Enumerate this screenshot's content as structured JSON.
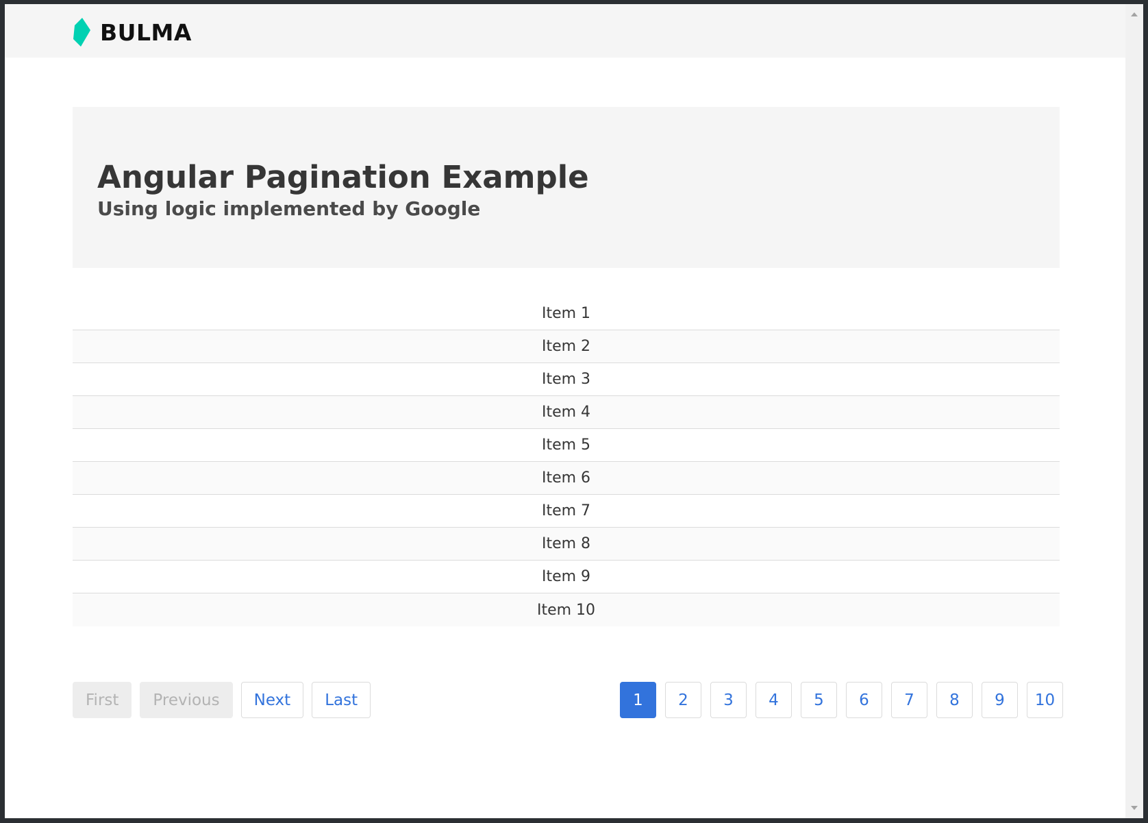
{
  "navbar": {
    "brand_text": "BULMA",
    "brand_color": "#00d1b2"
  },
  "hero": {
    "title": "Angular Pagination Example",
    "subtitle": "Using logic implemented by Google"
  },
  "items": [
    "Item 1",
    "Item 2",
    "Item 3",
    "Item 4",
    "Item 5",
    "Item 6",
    "Item 7",
    "Item 8",
    "Item 9",
    "Item 10"
  ],
  "pagination": {
    "first_label": "First",
    "previous_label": "Previous",
    "next_label": "Next",
    "last_label": "Last",
    "pages": [
      "1",
      "2",
      "3",
      "4",
      "5",
      "6",
      "7",
      "8",
      "9",
      "10"
    ],
    "current_page": "1",
    "accent_color": "#3273dc"
  }
}
